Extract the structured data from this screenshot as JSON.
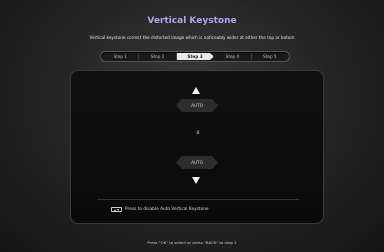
{
  "header": {
    "title": "Vertical Keystone",
    "subtitle": "Vertical keystone correct the distorted image which is noticeably wider at either the top or botom"
  },
  "steps": [
    {
      "label": "Step 1",
      "active": false
    },
    {
      "label": "Step 2",
      "active": false
    },
    {
      "label": "Step 3",
      "active": true
    },
    {
      "label": "Step 4",
      "active": false
    },
    {
      "label": "Step 5",
      "active": false
    }
  ],
  "panel": {
    "auto_top_label": "AUTO",
    "value": "0",
    "auto_bottom_label": "AUTO",
    "hint_text": "Press to disable Auto Vertical Keystone",
    "hint_icon": "up-down-keys-icon"
  },
  "footer": {
    "text": "Press \"OK\" to select or press \"BACK\" to step 2"
  },
  "colors": {
    "title": "#b7a0ee",
    "active_step_bg": "#e9e9e9",
    "panel_bg": "#0a0a0a"
  }
}
